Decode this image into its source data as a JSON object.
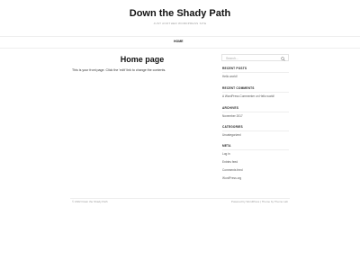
{
  "site": {
    "title": "Down the Shady Path",
    "description": "Just another WordPress site"
  },
  "nav": {
    "items": [
      {
        "label": "HOME"
      }
    ]
  },
  "main": {
    "title": "Home page",
    "content": "This is your front page. Click the 'edit' link to change the contents."
  },
  "sidebar": {
    "search": {
      "placeholder": "Search..."
    },
    "recent_posts": {
      "title": "RECENT POSTS",
      "items": [
        "Hello world!"
      ]
    },
    "recent_comments": {
      "title": "RECENT COMMENTS",
      "items": [
        "A WordPress Commenter on Hello world!"
      ]
    },
    "archives": {
      "title": "ARCHIVES",
      "items": [
        "November 2017"
      ]
    },
    "categories": {
      "title": "CATEGORIES",
      "items": [
        "Uncategorized"
      ]
    },
    "meta": {
      "title": "META",
      "items": [
        "Log in",
        "Entries feed",
        "Comments feed",
        "WordPress.org"
      ]
    }
  },
  "footer": {
    "left": "© 2022 Down the Shady Path",
    "right": "Powered by WordPress | Theme by Theme Lab"
  },
  "colors": {
    "text": "#222222",
    "muted": "#999999",
    "border": "#eeeeee",
    "background": "#ffffff"
  }
}
